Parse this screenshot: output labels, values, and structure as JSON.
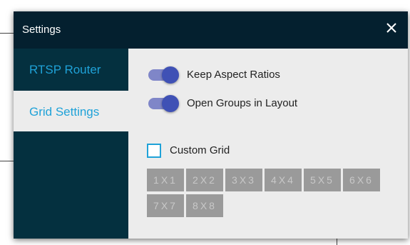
{
  "dialog": {
    "title": "Settings",
    "close_icon": "close-icon"
  },
  "sidebar": {
    "items": [
      {
        "label": "RTSP Router",
        "active": false
      },
      {
        "label": "Grid Settings",
        "active": true
      }
    ]
  },
  "grid_settings": {
    "toggles": [
      {
        "label": "Keep Aspect Ratios",
        "on": true
      },
      {
        "label": "Open Groups in Layout",
        "on": true
      }
    ],
    "custom_grid": {
      "label": "Custom Grid",
      "checked": false
    },
    "grid_options": [
      "1X1",
      "2X2",
      "3X3",
      "4X4",
      "5X5",
      "6X6",
      "7X7",
      "8X8"
    ]
  },
  "colors": {
    "titlebar": "#04202f",
    "sidebar": "#04303f",
    "accent": "#1fa2d8",
    "toggle_on": "#3f51b5",
    "grid_button": "#9a9a9a"
  }
}
